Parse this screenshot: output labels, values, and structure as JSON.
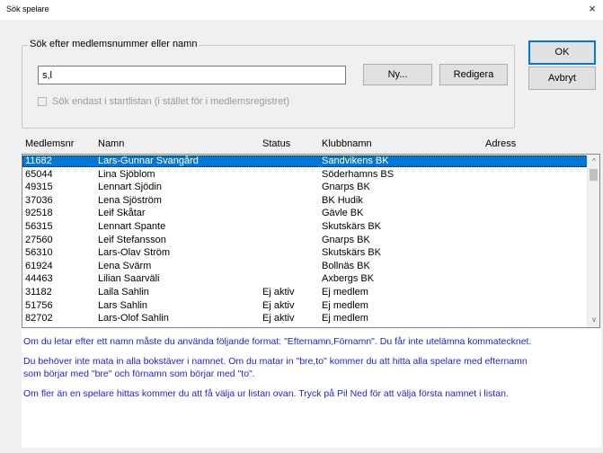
{
  "window": {
    "title": "Sök spelare",
    "close_glyph": "×"
  },
  "search": {
    "group_label": "Sök efter medlemsnummer eller namn",
    "value": "s,l",
    "only_startlist_label": "Sök endast i startlistan (i stället för i medlemsregistret)"
  },
  "buttons": {
    "ny": "Ny...",
    "redigera": "Redigera",
    "ok": "OK",
    "avbryt": "Avbryt"
  },
  "columns": [
    "Medlemsnr",
    "Namn",
    "Status",
    "Klubbnamn",
    "Adress"
  ],
  "rows": [
    {
      "nr": "11682",
      "name": "Lars-Gunnar Svangård",
      "status": "",
      "club": "Sandvikens BK",
      "address": "",
      "selected": true
    },
    {
      "nr": "65044",
      "name": "Lina Sjöblom",
      "status": "",
      "club": "Söderhamns BS",
      "address": ""
    },
    {
      "nr": "49315",
      "name": "Lennart Sjödin",
      "status": "",
      "club": "Gnarps BK",
      "address": ""
    },
    {
      "nr": "37036",
      "name": "Lena Sjöström",
      "status": "",
      "club": "BK Hudik",
      "address": ""
    },
    {
      "nr": "92518",
      "name": "Leif Skåtar",
      "status": "",
      "club": "Gävle BK",
      "address": ""
    },
    {
      "nr": "56315",
      "name": "Lennart Spante",
      "status": "",
      "club": "Skutskärs BK",
      "address": ""
    },
    {
      "nr": "27560",
      "name": "Leif Stefansson",
      "status": "",
      "club": "Gnarps BK",
      "address": ""
    },
    {
      "nr": "56310",
      "name": "Lars-Olav Ström",
      "status": "",
      "club": "Skutskärs BK",
      "address": ""
    },
    {
      "nr": "61924",
      "name": "Lena Svärm",
      "status": "",
      "club": "Bollnäs BK",
      "address": ""
    },
    {
      "nr": "44463",
      "name": "Lilian Saarväli",
      "status": "",
      "club": "Axbergs BK",
      "address": ""
    },
    {
      "nr": "31182",
      "name": "Laila Sahlin",
      "status": "Ej aktiv",
      "club": "Ej medlem",
      "address": ""
    },
    {
      "nr": "51756",
      "name": "Lars Sahlin",
      "status": "Ej aktiv",
      "club": "Ej medlem",
      "address": ""
    },
    {
      "nr": "82702",
      "name": "Lars-Olof Sahlin",
      "status": "Ej aktiv",
      "club": "Ej medlem",
      "address": ""
    }
  ],
  "scrollbar": {
    "up_glyph": "^",
    "down_glyph": "v"
  },
  "help": {
    "p1": "Om du letar efter ett namn måste du använda följande format: \"Efternamn,Förnamn\". Du får inte utelämna kommatecknet.",
    "p2": "Du behöver inte mata in alla bokstäver i namnet. Om du matar in \"bre,to\" kommer du att hitta alla spelare med efternamn\nsom börjar med \"bre\" och förnamn som börjar med \"to\".",
    "p3": "Om fler än en spelare hittas kommer du att få välja ur listan ovan. Tryck på Pil Ned för att välja första namnet i listan."
  },
  "colors": {
    "selection": "#0078d7",
    "help_text": "#2222cc",
    "dialog_bg": "#f0f0f0"
  }
}
